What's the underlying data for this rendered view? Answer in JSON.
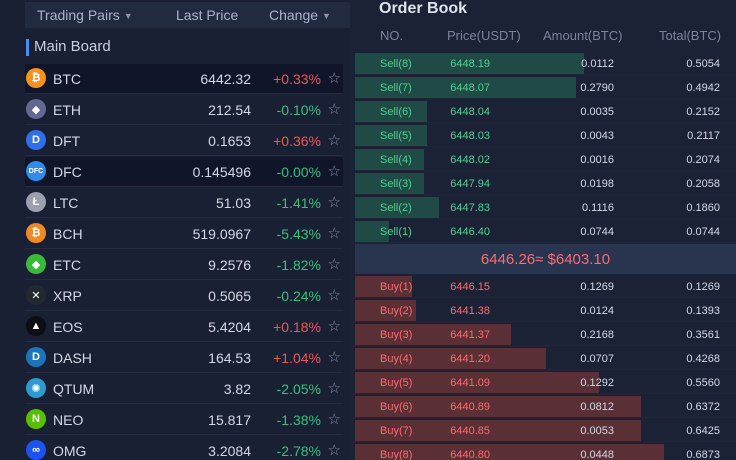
{
  "pairs_header": {
    "pair": "Trading Pairs",
    "last_price": "Last Price",
    "change": "Change"
  },
  "board_title": "Main Board",
  "pairs": [
    {
      "icon": "bitcoin-icon",
      "glyph": "₿",
      "color": "#f7931a",
      "name": "BTC",
      "price": "6442.32",
      "change": "+0.33%",
      "dir": "up"
    },
    {
      "icon": "ethereum-icon",
      "glyph": "◆",
      "color": "#62688f",
      "name": "ETH",
      "price": "212.54",
      "change": "-0.10%",
      "dir": "down"
    },
    {
      "icon": "dft-icon",
      "glyph": "D",
      "color": "#2f6fea",
      "name": "DFT",
      "price": "0.1653",
      "change": "+0.36%",
      "dir": "up"
    },
    {
      "icon": "dfc-icon",
      "glyph": "DFC",
      "color": "#2f8cea",
      "name": "DFC",
      "price": "0.145496",
      "change": "-0.00%",
      "dir": "down"
    },
    {
      "icon": "litecoin-icon",
      "glyph": "Ł",
      "color": "#9aa0ad",
      "name": "LTC",
      "price": "51.03",
      "change": "-1.41%",
      "dir": "down"
    },
    {
      "icon": "bitcoin-cash-icon",
      "glyph": "₿",
      "color": "#f08a24",
      "name": "BCH",
      "price": "519.0967",
      "change": "-5.43%",
      "dir": "down"
    },
    {
      "icon": "ethereum-classic-icon",
      "glyph": "◆",
      "color": "#3ab83a",
      "name": "ETC",
      "price": "9.2576",
      "change": "-1.82%",
      "dir": "down"
    },
    {
      "icon": "ripple-icon",
      "glyph": "✕",
      "color": "#23292f",
      "name": "XRP",
      "price": "0.5065",
      "change": "-0.24%",
      "dir": "down"
    },
    {
      "icon": "eos-icon",
      "glyph": "▲",
      "color": "#0b0e14",
      "name": "EOS",
      "price": "5.4204",
      "change": "+0.18%",
      "dir": "up"
    },
    {
      "icon": "dash-icon",
      "glyph": "D",
      "color": "#1c75bc",
      "name": "DASH",
      "price": "164.53",
      "change": "+1.04%",
      "dir": "up"
    },
    {
      "icon": "qtum-icon",
      "glyph": "✺",
      "color": "#2e9ad0",
      "name": "QTUM",
      "price": "3.82",
      "change": "-2.05%",
      "dir": "down"
    },
    {
      "icon": "neo-icon",
      "glyph": "N",
      "color": "#58bf00",
      "name": "NEO",
      "price": "15.817",
      "change": "-1.38%",
      "dir": "down"
    },
    {
      "icon": "omg-icon",
      "glyph": "∞",
      "color": "#1a53f0",
      "name": "OMG",
      "price": "3.2084",
      "change": "-2.78%",
      "dir": "down"
    }
  ],
  "order_book": {
    "title": "Order Book",
    "columns": {
      "no": "NO.",
      "price": "Price(USDT)",
      "amount": "Amount(BTC)",
      "total": "Total(BTC)"
    },
    "sells": [
      {
        "label": "Sell(8)",
        "price": "6448.19",
        "amount": "0.0112",
        "total": "0.5054",
        "depth": 0.6
      },
      {
        "label": "Sell(7)",
        "price": "6448.07",
        "amount": "0.2790",
        "total": "0.4942",
        "depth": 0.58
      },
      {
        "label": "Sell(6)",
        "price": "6448.04",
        "amount": "0.0035",
        "total": "0.2152",
        "depth": 0.19
      },
      {
        "label": "Sell(5)",
        "price": "6448.03",
        "amount": "0.0043",
        "total": "0.2117",
        "depth": 0.19
      },
      {
        "label": "Sell(4)",
        "price": "6448.02",
        "amount": "0.0016",
        "total": "0.2074",
        "depth": 0.18
      },
      {
        "label": "Sell(3)",
        "price": "6447.94",
        "amount": "0.0198",
        "total": "0.2058",
        "depth": 0.18
      },
      {
        "label": "Sell(2)",
        "price": "6447.83",
        "amount": "0.1116",
        "total": "0.1860",
        "depth": 0.22
      },
      {
        "label": "Sell(1)",
        "price": "6446.40",
        "amount": "0.0744",
        "total": "0.0744",
        "depth": 0.09
      }
    ],
    "mid_price": "6446.26≈ $6403.10",
    "buys": [
      {
        "label": "Buy(1)",
        "price": "6446.15",
        "amount": "0.1269",
        "total": "0.1269",
        "depth": 0.15
      },
      {
        "label": "Buy(2)",
        "price": "6441.38",
        "amount": "0.0124",
        "total": "0.1393",
        "depth": 0.16
      },
      {
        "label": "Buy(3)",
        "price": "6441.37",
        "amount": "0.2168",
        "total": "0.3561",
        "depth": 0.41
      },
      {
        "label": "Buy(4)",
        "price": "6441.20",
        "amount": "0.0707",
        "total": "0.4268",
        "depth": 0.5
      },
      {
        "label": "Buy(5)",
        "price": "6441.09",
        "amount": "0.1292",
        "total": "0.5560",
        "depth": 0.64
      },
      {
        "label": "Buy(6)",
        "price": "6440.89",
        "amount": "0.0812",
        "total": "0.6372",
        "depth": 0.75
      },
      {
        "label": "Buy(7)",
        "price": "6440.85",
        "amount": "0.0053",
        "total": "0.6425",
        "depth": 0.75
      },
      {
        "label": "Buy(8)",
        "price": "6440.80",
        "amount": "0.0448",
        "total": "0.6873",
        "depth": 0.81
      }
    ]
  }
}
